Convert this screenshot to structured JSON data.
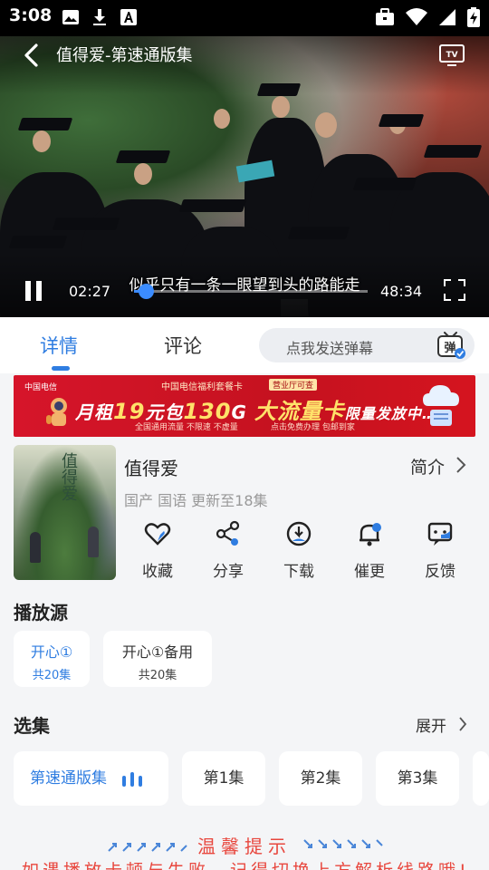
{
  "status_bar": {
    "time": "3:08"
  },
  "player": {
    "title": "值得爱-第速通版集",
    "subtitle": "似乎只有一条一眼望到头的路能走",
    "current_time": "02:27",
    "total_time": "48:34",
    "progress": 0.05
  },
  "tabs": [
    {
      "label": "详情"
    },
    {
      "label": "评论"
    }
  ],
  "danmu": {
    "placeholder": "点我发送弹幕",
    "icon_label": "弹"
  },
  "banner": {
    "logo": "中国电信",
    "top_line": "中国电信福利套餐卡",
    "tag": "营业厅可查",
    "main_prefix": "月租",
    "price": "19",
    "main_mid": "元包",
    "data_amount": "130",
    "data_unit": "G",
    "main_suffix": "大流量卡",
    "tail": "限量发放中……",
    "sub_left": "全国通用流量  不限速  不虚量",
    "sub_right": "点击免费办理  包邮到家"
  },
  "show": {
    "title": "值得爱",
    "poster_title": "值得爱",
    "meta": "国产 国语 更新至18集",
    "intro_label": "简介"
  },
  "actions": [
    {
      "label": "收藏",
      "icon": "heart-icon"
    },
    {
      "label": "分享",
      "icon": "share-icon"
    },
    {
      "label": "下载",
      "icon": "download-icon"
    },
    {
      "label": "催更",
      "icon": "bell-icon"
    },
    {
      "label": "反馈",
      "icon": "feedback-icon"
    }
  ],
  "source_section": {
    "title": "播放源",
    "sources": [
      {
        "name": "开心①",
        "count": "共20集"
      },
      {
        "name": "开心①备用",
        "count": "共20集"
      }
    ]
  },
  "episode_section": {
    "title": "选集",
    "expand_label": "展开",
    "episodes": [
      "第速通版集",
      "第1集",
      "第2集",
      "第3集"
    ]
  },
  "tips": {
    "title": "温馨提示",
    "body": "如遇播放卡顿与失败，记得切换上方解析线路哦!"
  },
  "colors": {
    "accent": "#2f7de1",
    "warning": "#e8473e",
    "banner_red": "#d6152a"
  }
}
